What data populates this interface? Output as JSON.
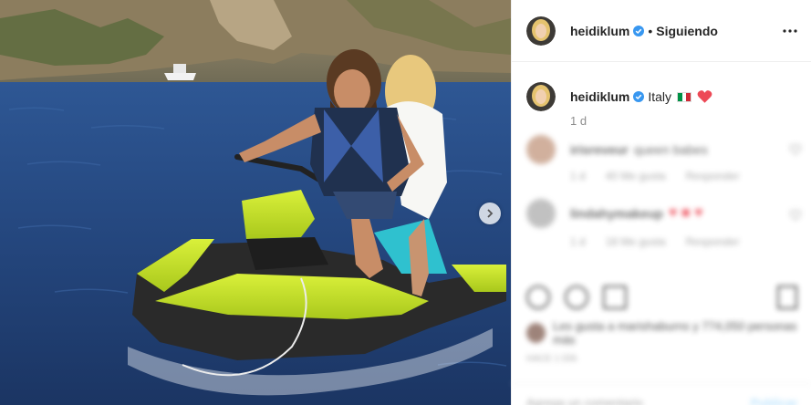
{
  "header": {
    "username": "heidiklum",
    "separator": "•",
    "follow_label": "Siguiendo"
  },
  "caption": {
    "username": "heidiklum",
    "text": "Italy",
    "time": "1 d"
  },
  "comments_blurred": [
    {
      "username": "irisreveur",
      "text": "queen babes"
    },
    {
      "username": "lindahymakeup",
      "text": ""
    }
  ],
  "comment_meta": [
    {
      "time": "1 d",
      "likes": "40 Me gusta",
      "reply": "Responder"
    },
    {
      "time": "1 d",
      "likes": "18 Me gusta",
      "reply": "Responder"
    }
  ],
  "likes": {
    "text": "Les gusta a marishaburns y 774,050 personas más"
  },
  "date_label": "Hace 1 día",
  "comment_box": {
    "placeholder": "Agrega un comentario",
    "publish_label": "Publicar"
  },
  "colors": {
    "verified": "#3897f0",
    "heart": "#ed4956",
    "publish": "#b2dffc",
    "flag_green": "#009246",
    "flag_red": "#ce2b37"
  },
  "icons": {
    "verified": "verified-badge-icon",
    "more": "more-options-icon",
    "next": "chevron-right-icon"
  }
}
